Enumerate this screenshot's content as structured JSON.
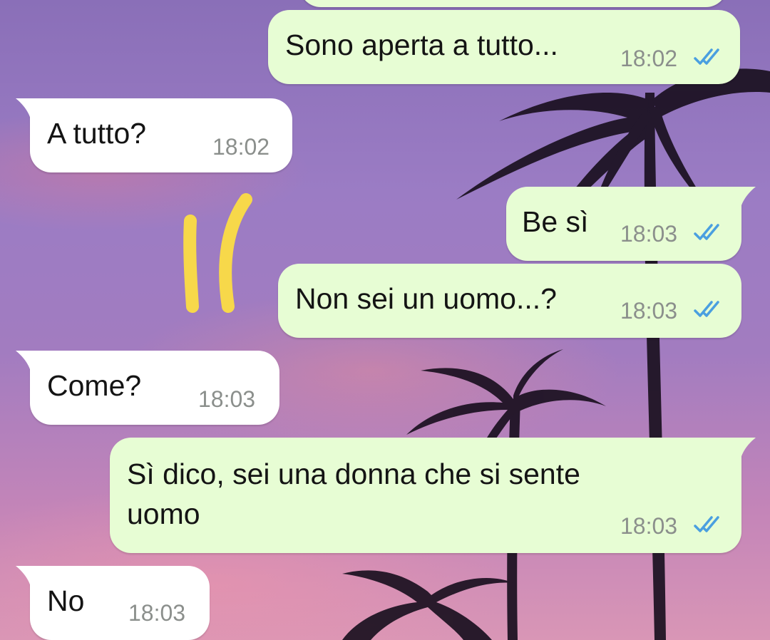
{
  "theme": {
    "outgoing_bubble": "#e7fdd4",
    "incoming_bubble": "#ffffff",
    "read_check": "#4a9fe0",
    "annotation": "#f7d84a"
  },
  "annotation": {
    "marks": "''",
    "icon": "yellow-double-stroke-annotation"
  },
  "messages": [
    {
      "direction": "outgoing",
      "text": "Sono aperta a tutto...",
      "time": "18:02",
      "status": "read"
    },
    {
      "direction": "incoming",
      "text": "A tutto?",
      "time": "18:02"
    },
    {
      "direction": "outgoing",
      "text": "Be sì",
      "time": "18:03",
      "status": "read"
    },
    {
      "direction": "outgoing",
      "text": "Non sei un uomo...?",
      "time": "18:03",
      "status": "read"
    },
    {
      "direction": "incoming",
      "text": "Come?",
      "time": "18:03"
    },
    {
      "direction": "outgoing",
      "text_line1": "Sì dico, sei una donna che si sente",
      "text_line2": "uomo",
      "time": "18:03",
      "status": "read"
    },
    {
      "direction": "incoming",
      "text": "No",
      "time": "18:03"
    }
  ]
}
